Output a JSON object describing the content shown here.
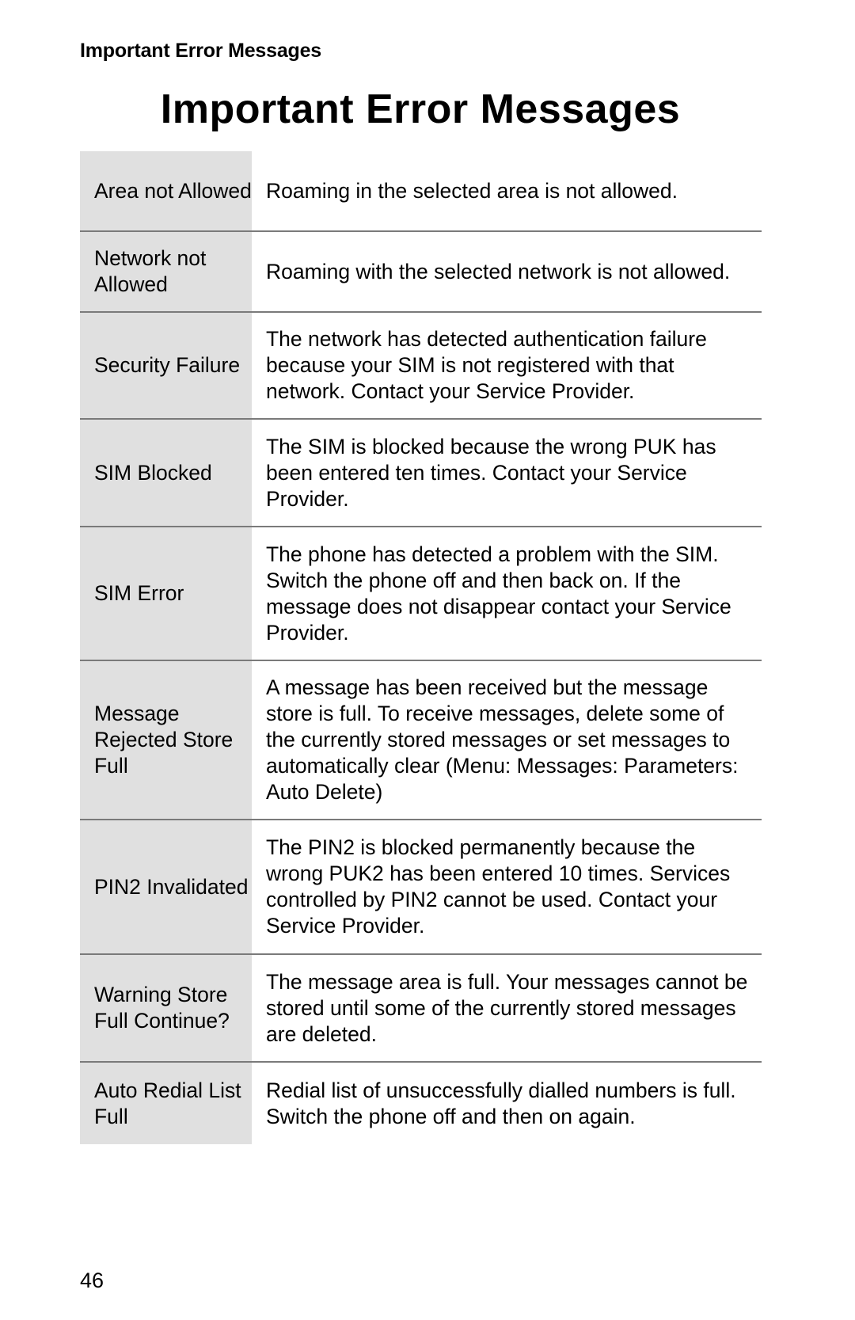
{
  "running_header": "Important Error Messages",
  "title": "Important Error Messages",
  "rows": [
    {
      "term": "Area not Allowed",
      "description": "Roaming in the selected area is not allowed."
    },
    {
      "term": "Network not Allowed",
      "description": "Roaming with the selected network is not allowed."
    },
    {
      "term": "Security Failure",
      "description": "The network has detected authentication failure because your SIM is not registered with that network. Contact your Service Provider."
    },
    {
      "term": "SIM Blocked",
      "description": "The SIM is blocked because the wrong PUK has been entered ten times. Contact your Service Provider."
    },
    {
      "term": "SIM Error",
      "description": "The phone has detected a problem with the SIM. Switch the phone off and then back on. If the message does not disappear contact your Service Provider."
    },
    {
      "term": "Message Rejected Store Full",
      "description": "A message has been received but the message store is full. To receive messages, delete some of the currently stored messages or set messages to automatically clear (Menu: Messages: Parameters: Auto Delete)"
    },
    {
      "term": "PIN2 Invalidated",
      "description": "The PIN2 is blocked permanently because the wrong PUK2 has been entered 10 times. Services controlled by PIN2 cannot be used. Contact your Service Provider."
    },
    {
      "term": "Warning Store Full Continue?",
      "description": "The message area is full. Your messages cannot be stored until some of the currently stored messages are deleted."
    },
    {
      "term": "Auto Redial List Full",
      "description": "Redial list of unsuccessfully dialled numbers is full. Switch the phone off and then on again."
    }
  ],
  "page_number": "46",
  "colors": {
    "term_background": "#e0e0e0",
    "divider": "#7a7a7a",
    "text": "#000000"
  }
}
